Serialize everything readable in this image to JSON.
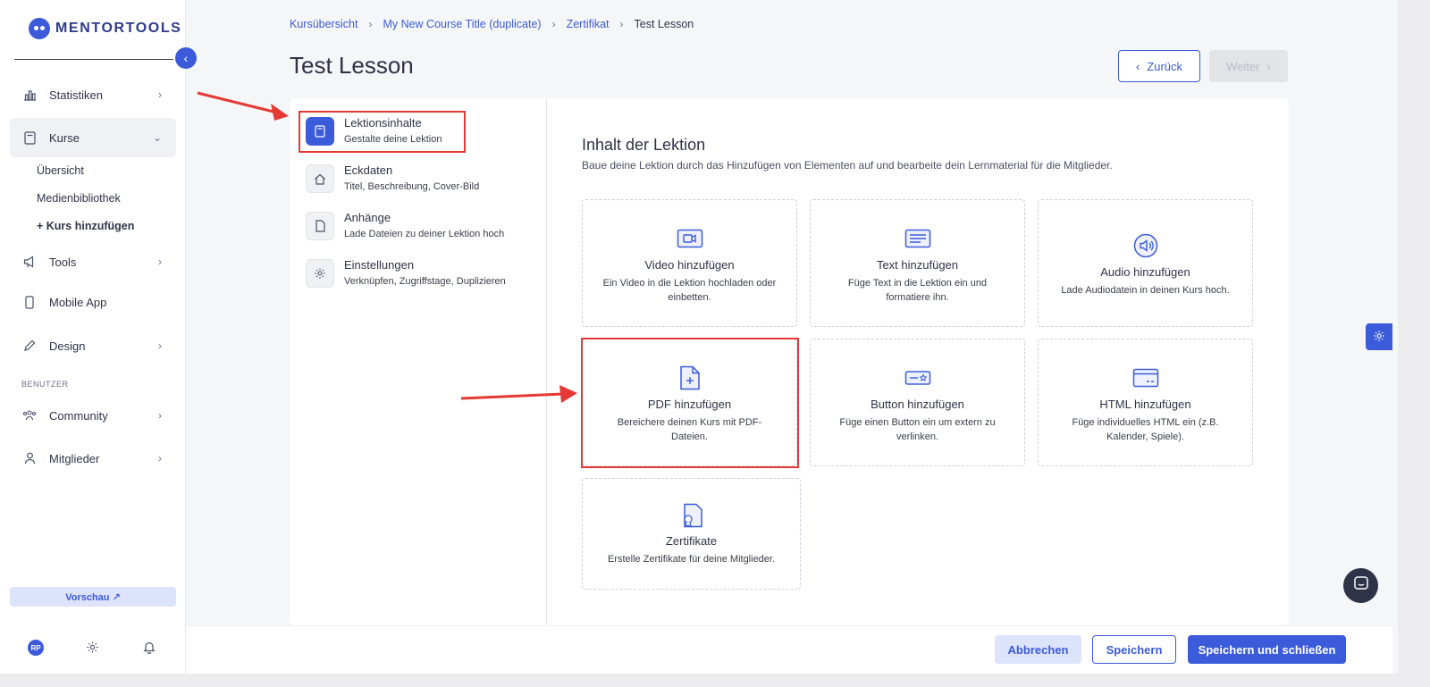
{
  "brand": {
    "name": "MENTORTOOLS",
    "accent": "#3b5bdb",
    "highlight": "#e53935"
  },
  "sidebar": {
    "items": [
      {
        "label": "Statistiken",
        "icon": "bar-chart-icon"
      },
      {
        "label": "Kurse",
        "icon": "book-icon"
      },
      {
        "label": "Tools",
        "icon": "megaphone-icon"
      },
      {
        "label": "Mobile App",
        "icon": "phone-icon"
      },
      {
        "label": "Design",
        "icon": "pencil-icon"
      },
      {
        "label": "Community",
        "icon": "people-icon"
      },
      {
        "label": "Mitglieder",
        "icon": "user-icon"
      }
    ],
    "kurse_sub": [
      "Übersicht",
      "Medienbibliothek",
      "+ Kurs hinzufügen"
    ],
    "section_users": "BENUTZER",
    "preview_label": "Vorschau ↗",
    "avatar_initials": "RP"
  },
  "breadcrumb": [
    "Kursübersicht",
    "My New Course Title (duplicate)",
    "Zertifikat",
    "Test Lesson"
  ],
  "page_title": "Test Lesson",
  "nav_buttons": {
    "back": "Zurück",
    "next": "Weiter"
  },
  "steps": [
    {
      "title": "Lektionsinhalte",
      "subtitle": "Gestalte deine Lektion",
      "icon": "book-icon"
    },
    {
      "title": "Eckdaten",
      "subtitle": "Titel, Beschreibung, Cover-Bild",
      "icon": "home-icon"
    },
    {
      "title": "Anhänge",
      "subtitle": "Lade Dateien zu deiner Lektion hoch",
      "icon": "file-icon"
    },
    {
      "title": "Einstellungen",
      "subtitle": "Verknüpfen, Zugriffstage, Duplizieren",
      "icon": "gear-icon"
    }
  ],
  "content": {
    "title": "Inhalt der Lektion",
    "subtitle": "Baue deine Lektion durch das Hinzufügen von Elementen auf und bearbeite dein Lernmaterial für die Mitglieder."
  },
  "tiles": [
    {
      "title": "Video hinzufügen",
      "desc": "Ein Video in die Lektion hochladen oder einbetten.",
      "icon": "video-icon"
    },
    {
      "title": "Text hinzufügen",
      "desc": "Füge Text in die Lektion ein und formatiere ihn.",
      "icon": "text-icon"
    },
    {
      "title": "Audio hinzufügen",
      "desc": "Lade Audiodatein in deinen Kurs hoch.",
      "icon": "audio-icon"
    },
    {
      "title": "PDF hinzufügen",
      "desc": "Bereichere deinen Kurs mit PDF-Dateien.",
      "icon": "pdf-icon"
    },
    {
      "title": "Button hinzufügen",
      "desc": "Füge einen Button ein um extern zu verlinken.",
      "icon": "button-icon"
    },
    {
      "title": "HTML hinzufügen",
      "desc": "Füge individuelles HTML ein (z.B. Kalender, Spiele).",
      "icon": "html-icon"
    },
    {
      "title": "Zertifikate",
      "desc": "Erstelle Zertifikate für deine Mitglieder.",
      "icon": "certificate-icon"
    }
  ],
  "footer": {
    "cancel": "Abbrechen",
    "save": "Speichern",
    "save_close": "Speichern und schließen"
  }
}
